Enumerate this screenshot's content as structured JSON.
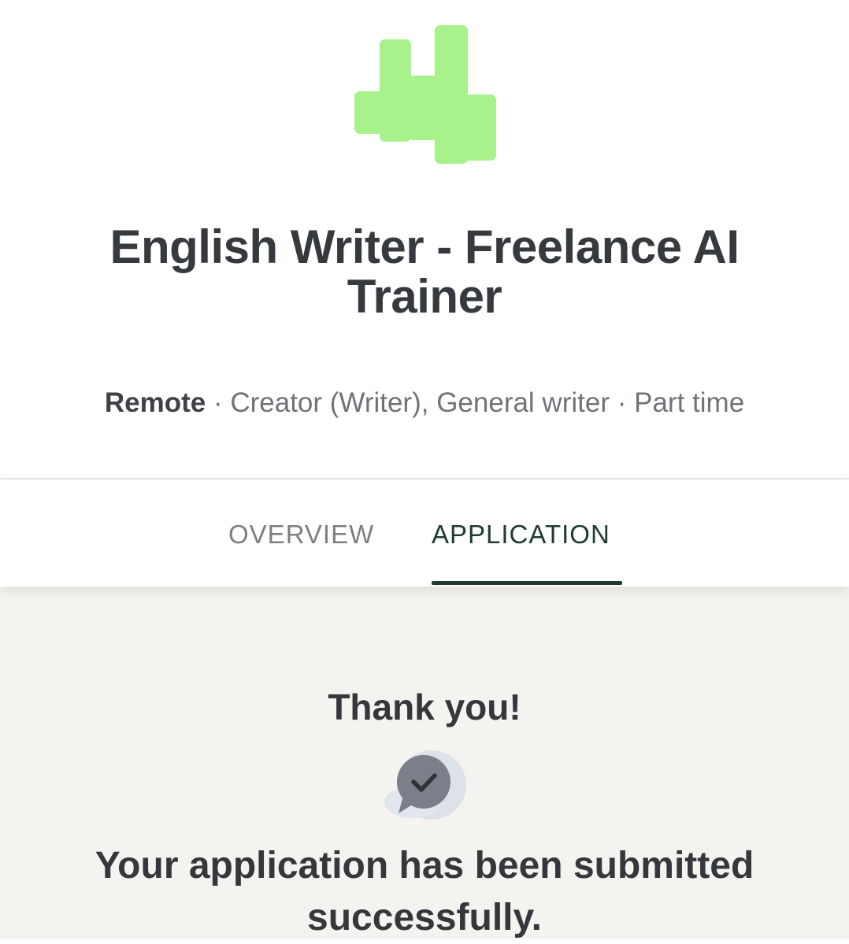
{
  "company": {
    "logo_icon": "brand-logo-icon",
    "logo_color": "#a8f28c"
  },
  "job": {
    "title": "English Writer - Freelance AI Trainer",
    "location": "Remote",
    "separator": "·",
    "category": "Creator (Writer), General writer",
    "employment_type": "Part time"
  },
  "tabs": [
    {
      "label": "OVERVIEW",
      "active": false
    },
    {
      "label": "APPLICATION",
      "active": true
    }
  ],
  "confirmation": {
    "heading": "Thank you!",
    "icon": "chat-check-icon",
    "message": "Your application has been submitted successfully."
  },
  "colors": {
    "accent": "#1f3b32",
    "content_background": "#f4f3f0",
    "text_primary": "#34373b",
    "text_secondary": "#6f7378"
  }
}
